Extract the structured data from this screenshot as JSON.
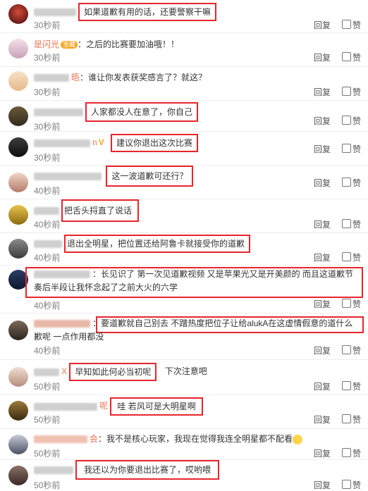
{
  "actions": {
    "reply": "回复",
    "like": "赞"
  },
  "comments": [
    {
      "name": "",
      "text": "如果道歉有用的话，还要警察干嘛",
      "time": "30秒前"
    },
    {
      "name": "是闪光",
      "badge": "宝藏",
      "text": "：之后的比赛要加油哦！！",
      "time": "30秒前"
    },
    {
      "name": "",
      "suffix": "晤",
      "text": "：谁让你发表获奖感言了？就这？",
      "time": "30秒前"
    },
    {
      "name": "",
      "text": "人家都没人在意了，你自己",
      "time": "30秒前"
    },
    {
      "name": "",
      "suffix": "n",
      "text": "建议你退出这次比赛",
      "time": "30秒前"
    },
    {
      "name": "",
      "text": "这一波道歉可还行？",
      "time": "40秒前"
    },
    {
      "name": "",
      "text": "把舌头捋直了说话",
      "time": "40秒前"
    },
    {
      "name": "",
      "text": "退出全明星，把位置还给阿鲁卡就接受你的道歉",
      "time": "40秒前"
    },
    {
      "name": "",
      "text": "长见识了  第一次见道歉视频 又是苹果光又是开美颜的 而且这道歉节奏后半段让我怀念起了之前大火的六学",
      "time": "40秒前"
    },
    {
      "name": "",
      "text": "要道歉就自己别去 不蹭热度把位子让给alukA在这虚情假意的道什么歉呢 一点作用都没",
      "time": "40秒前"
    },
    {
      "name": "X",
      "text": "早知如此何必当初呢",
      "extra": "下次注意吧",
      "time": "50秒前"
    },
    {
      "name": "",
      "suffix": "呢",
      "text": "哇 若风可是大明星啊",
      "time": "50秒前"
    },
    {
      "name": "",
      "suffix": "会",
      "text": "：我不是核心玩家，我现在觉得我连全明星都不配看",
      "time": "50秒前"
    },
    {
      "name": "",
      "text": "我还以为你要退出比赛了，哎哟喂",
      "time": "50秒前"
    }
  ]
}
